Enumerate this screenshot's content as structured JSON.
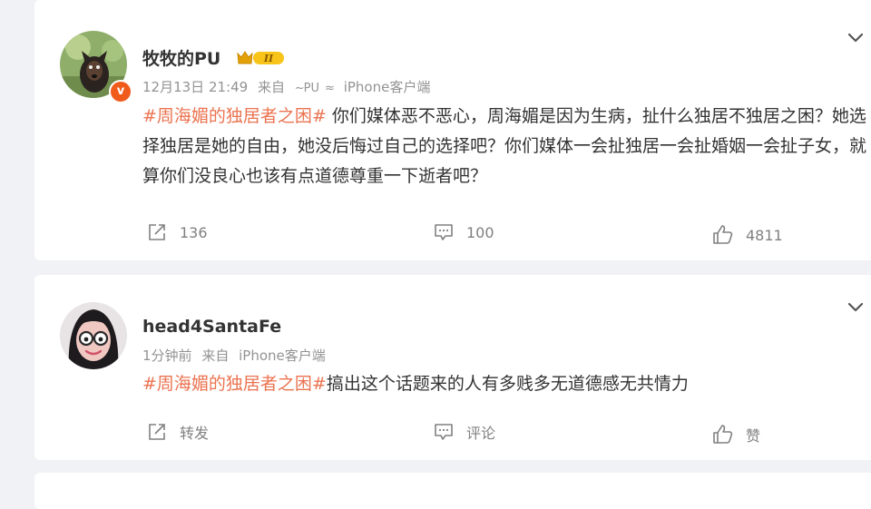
{
  "posts": [
    {
      "user_name": "牧牧的PU",
      "level": "II",
      "verified_mark": "v",
      "time": "12月13日 21:49",
      "from_prefix": "来自",
      "source_logo": "PU",
      "source": "iPhone客户端",
      "topic": "#周海媚的独居者之困#",
      "text": " 你们媒体恶不恶心，周海媚是因为生病，扯什么独居不独居之困？她选择独居是她的自由，她没后悔过自己的选择吧？你们媒体一会扯独居一会扯婚姻一会扯子女，就算你们没良心也该有点道德尊重一下逝者吧？",
      "forward": "136",
      "comment": "100",
      "like": "4811",
      "icons": {
        "forward": "share-icon",
        "comment": "comment-icon",
        "like": "thumbs-up-icon",
        "menu": "chevron-down-icon"
      }
    },
    {
      "user_name": "head4SantaFe",
      "time": "1分钟前",
      "from_prefix": "来自",
      "source": "iPhone客户端",
      "topic": "#周海媚的独居者之困#",
      "text": "搞出这个话题来的人有多贱多无道德感无共情力",
      "forward": "转发",
      "comment": "评论",
      "like": "赞"
    }
  ],
  "colors": {
    "topic": "#eb7350",
    "meta": "#939393",
    "background": "#f1f2f5",
    "verified": "#f05b1b",
    "level_badge": "#f8c41a"
  }
}
